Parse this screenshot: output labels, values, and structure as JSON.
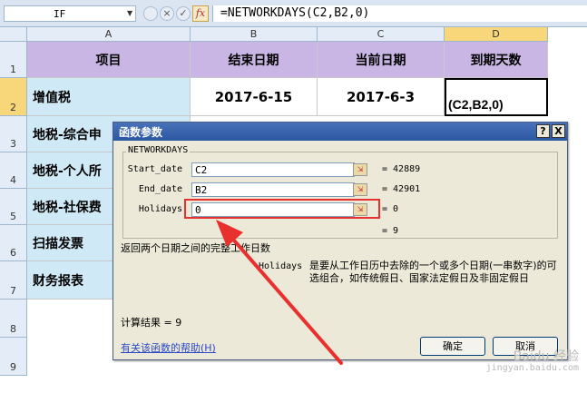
{
  "formula_bar": {
    "name_box": "IF",
    "cancel_icon": "×",
    "enter_icon": "✓",
    "fx_label": "fx",
    "formula": "=NETWORKDAYS(C2,B2,0)"
  },
  "columns": [
    "A",
    "B",
    "C",
    "D"
  ],
  "rows": [
    "1",
    "2",
    "3",
    "4",
    "5",
    "6",
    "7",
    "8",
    "9"
  ],
  "sheet": {
    "headers": [
      "项目",
      "结束日期",
      "当前日期",
      "到期天数"
    ],
    "labels": [
      "增值税",
      "地税-综合申",
      "地税-个人所",
      "地税-社保费",
      "扫描发票",
      "财务报表"
    ],
    "row2": {
      "end_date": "2017-6-15",
      "current_date": "2017-6-3",
      "editing": "(C2,B2,0)"
    }
  },
  "dialog": {
    "title": "函数参数",
    "help_btn": "?",
    "close_btn": "X",
    "function_name": "NETWORKDAYS",
    "args": [
      {
        "name": "Start_date",
        "value": "C2",
        "result": "= 42889"
      },
      {
        "name": "End_date",
        "value": "B2",
        "result": "= 42901"
      },
      {
        "name": "Holidays",
        "value": "0",
        "result": "= 0"
      }
    ],
    "func_result": "= 9",
    "description": "返回两个日期之间的完整工作日数",
    "arg_help_name": "Holidays",
    "arg_help_text": "是要从工作日历中去除的一个或多个日期(一串数字)的可选组合，如传统假日、国家法定假日及非固定假日",
    "calc_result": "计算结果 =  9",
    "help_link": "有关该函数的帮助(H)",
    "ok": "确定",
    "cancel": "取消"
  },
  "watermark": {
    "logo": "Baidu 经验",
    "url": "jingyan.baidu.com"
  },
  "colors": {
    "header_fill": "#c9b6e4",
    "label_fill": "#cfe9f6",
    "highlight": "#e8302f",
    "title_bar": "#2c57a2"
  }
}
